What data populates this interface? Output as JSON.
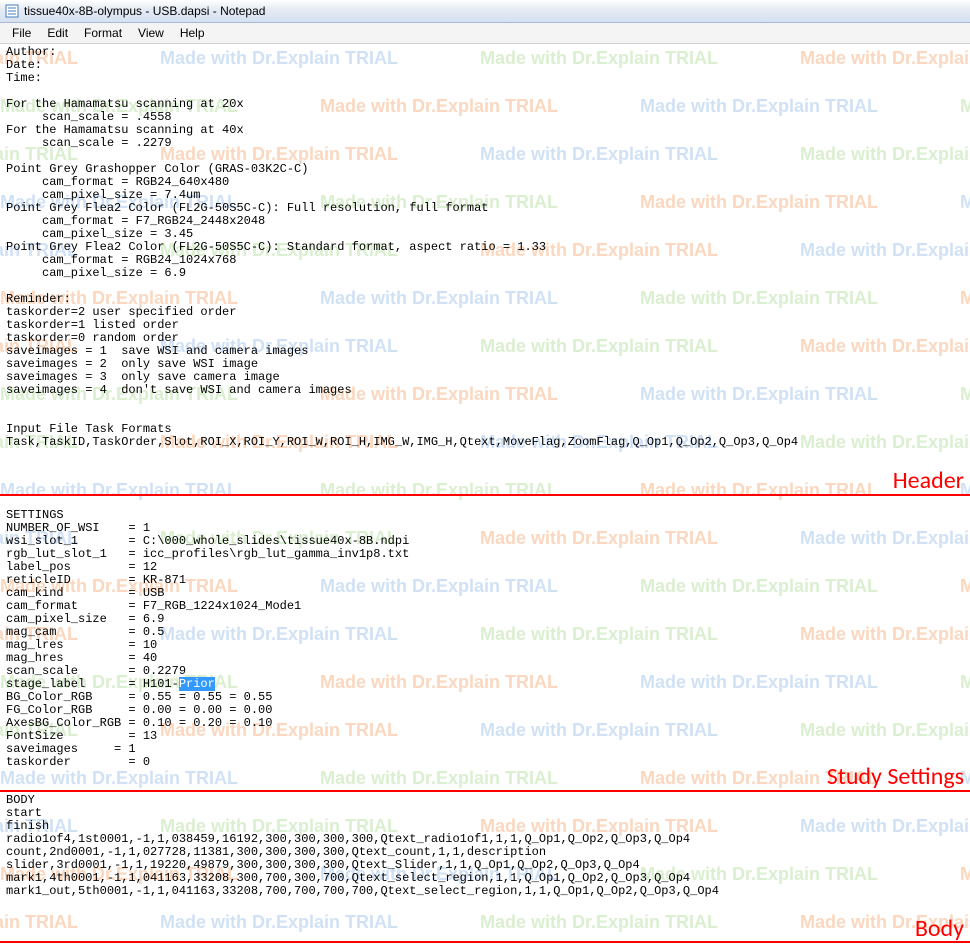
{
  "window": {
    "title": "tissue40x-8B-olympus - USB.dapsi - Notepad"
  },
  "menu": [
    "File",
    "Edit",
    "Format",
    "View",
    "Help"
  ],
  "watermark_text": "Made with Dr.Explain TRIAL",
  "sections": {
    "header_label": "Header",
    "settings_label": "Study Settings",
    "body_label": "Body"
  },
  "header_block": "Author:\nDate:\nTime:\n\nFor the Hamamatsu scanning at 20x\n     scan_scale = .4558\nFor the Hamamatsu scanning at 40x\n     scan_scale = .2279\n\nPoint Grey Grashopper Color (GRAS-03K2C-C)\n     cam_format = RGB24_640x480\n     cam_pixel_size = 7.4um\nPoint Grey Flea2 Color (FL2G-50S5C-C): Full resolution, full format\n     cam_format = F7_RGB24_2448x2048\n     cam_pixel_size = 3.45\nPoint Grey Flea2 Color (FL2G-50S5C-C): Standard format, aspect ratio = 1.33\n     cam_format = RGB24_1024x768\n     cam_pixel_size = 6.9\n\nReminder:\ntaskorder=2 user specified order\ntaskorder=1 listed order\ntaskorder=0 random order\nsaveimages = 1  save WSI and camera images\nsaveimages = 2  only save WSI image\nsaveimages = 3  only save camera image\nsaveimages = 4  don't save WSI and camera images\n\n\nInput File Task Formats\nTask,TaskID,TaskOrder,Slot,ROI_X,ROI_Y,ROI_W,ROI_H,IMG_W,IMG_H,Qtext,MoveFlag,ZoomFlag,Q_Op1,Q_Op2,Q_Op3,Q_Op4\n",
  "settings_pre": "\nSETTINGS\nNUMBER_OF_WSI    = 1\nwsi_slot_1       = C:\\000_whole_slides\\tissue40x-8B.ndpi\nrgb_lut_slot_1   = icc_profiles\\rgb_lut_gamma_inv1p8.txt\nlabel_pos        = 12\nreticleID        = KR-871\ncam_kind         = USB\ncam_format       = F7_RGB_1224x1024_Mode1\ncam_pixel_size   = 6.9\nmag_cam          = 0.5\nmag_lres         = 10\nmag_hres         = 40\nscan_scale       = 0.2279\nstage_label      = H101-",
  "settings_highlight": "Prior",
  "settings_post": "\nBG_Color_RGB     = 0.55 = 0.55 = 0.55\nFG_Color_RGB     = 0.00 = 0.00 = 0.00\nAxesBG_Color_RGB = 0.10 = 0.20 = 0.10\nFontSize         = 13\nsaveimages     = 1\ntaskorder        = 0\n",
  "body_block": "BODY\nstart\nfinish\nradio1of4,1st0001,-1,1,038459,16192,300,300,300,300,Qtext_radio1of1,1,1,Q_Op1,Q_Op2,Q_Op3,Q_Op4\ncount,2nd0001,-1,1,027728,11381,300,300,300,300,Qtext_count,1,1,description\nslider,3rd0001,-1,1,19220,49879,300,300,300,300,Qtext_Slider,1,1,Q_Op1,Q_Op2,Q_Op3,Q_Op4\nmark1,4th0001,-1,1,041163,33208,300,700,300,700,Qtext_select_region,1,1,Q_Op1,Q_Op2,Q_Op3,Q_Op4\nmark1_out,5th0001,-1,1,041163,33208,700,700,700,700,Qtext_select_region,1,1,Q_Op1,Q_Op2,Q_Op3,Q_Op4"
}
